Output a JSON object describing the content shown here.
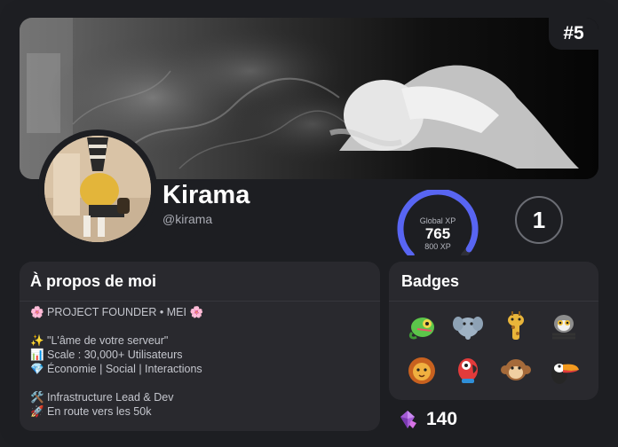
{
  "profile": {
    "rank": "#5",
    "username": "Kirama",
    "handle": "@kirama",
    "level": "1"
  },
  "xp": {
    "label": "Global XP",
    "value": "765",
    "max_label": "800 XP",
    "progress": 0.956
  },
  "about": {
    "title": "À propos de moi",
    "lines": [
      "🌸 PROJECT FOUNDER • MEI 🌸",
      "",
      "✨ \"L'âme de votre serveur\"",
      "📊 Scale : 30,000+ Utilisateurs",
      "💎 Économie | Social | Interactions",
      "",
      "🛠️ Infrastructure Lead & Dev",
      "🚀 En route vers les 50k"
    ]
  },
  "badges": {
    "title": "Badges",
    "items": [
      "chameleon",
      "elephant",
      "giraffe",
      "lemur",
      "lion",
      "parrot",
      "monkey",
      "toucan"
    ]
  },
  "gems": {
    "icon": "gem-icon",
    "value": "140"
  },
  "colors": {
    "accent": "#5865f2",
    "card": "#1d1e22",
    "panel": "#29292e"
  }
}
